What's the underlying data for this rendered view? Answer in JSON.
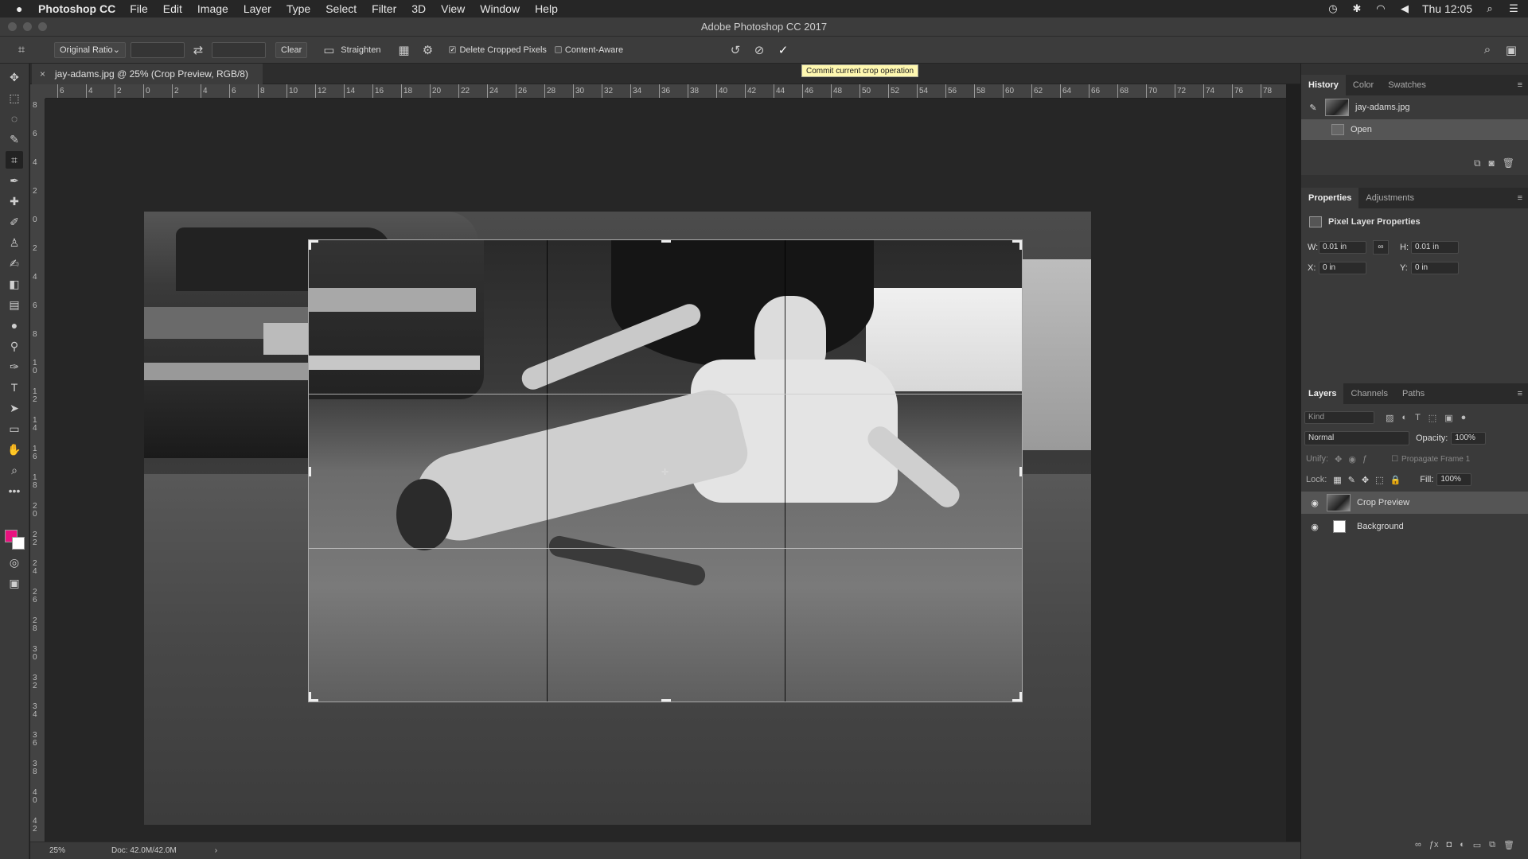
{
  "menubar": {
    "app_name": "Photoshop CC",
    "items": [
      "File",
      "Edit",
      "Image",
      "Layer",
      "Type",
      "Select",
      "Filter",
      "3D",
      "View",
      "Window",
      "Help"
    ],
    "clock": "Thu 12:05"
  },
  "window": {
    "title": "Adobe Photoshop CC 2017"
  },
  "options": {
    "ratio_label": "Original Ratio",
    "clear_label": "Clear",
    "straighten_label": "Straighten",
    "delete_cropped_label": "Delete Cropped Pixels",
    "delete_cropped_checked": true,
    "content_aware_label": "Content-Aware",
    "content_aware_checked": false,
    "tooltip": "Commit current crop operation"
  },
  "document": {
    "tab_title": "jay-adams.jpg @ 25% (Crop Preview, RGB/8)",
    "close_glyph": "×",
    "ruler_top": [
      "6",
      "4",
      "2",
      "0",
      "2",
      "4",
      "6",
      "8",
      "10",
      "12",
      "14",
      "16",
      "18",
      "20",
      "22",
      "24",
      "26",
      "28",
      "30",
      "32",
      "34",
      "36",
      "38",
      "40",
      "42",
      "44",
      "46",
      "48",
      "50",
      "52",
      "54",
      "56",
      "58",
      "60",
      "62",
      "64",
      "66",
      "68",
      "70",
      "72",
      "74",
      "76",
      "78"
    ],
    "ruler_left": [
      "8",
      "6",
      "4",
      "2",
      "0",
      "2",
      "4",
      "6",
      "8",
      "10",
      "12",
      "14",
      "16",
      "18",
      "20",
      "22",
      "24",
      "26",
      "28",
      "30",
      "32",
      "34",
      "36",
      "38",
      "40",
      "42"
    ]
  },
  "status": {
    "zoom": "25%",
    "doc_info": "Doc: 42.0M/42.0M"
  },
  "history": {
    "tabs": [
      "History",
      "Color",
      "Swatches"
    ],
    "snapshot": "jay-adams.jpg",
    "steps": [
      "Open"
    ]
  },
  "properties": {
    "tabs": [
      "Properties",
      "Adjustments"
    ],
    "heading": "Pixel Layer Properties",
    "w_label": "W:",
    "w_value": "0.01 in",
    "h_label": "H:",
    "h_value": "0.01 in",
    "x_label": "X:",
    "x_value": "0 in",
    "y_label": "Y:",
    "y_value": "0 in"
  },
  "layers": {
    "tabs": [
      "Layers",
      "Channels",
      "Paths"
    ],
    "filter_placeholder": "Kind",
    "blend_mode": "Normal",
    "opacity_label": "Opacity:",
    "opacity_value": "100%",
    "unify_label": "Unify:",
    "propagate_label": "Propagate Frame 1",
    "lock_label": "Lock:",
    "fill_label": "Fill:",
    "fill_value": "100%",
    "items": [
      {
        "name": "Crop Preview",
        "selected": true
      },
      {
        "name": "Background",
        "selected": false
      }
    ]
  },
  "colors": {
    "foreground": "#e8127f",
    "background": "#ffffff",
    "accent": "#2d8ceb"
  }
}
